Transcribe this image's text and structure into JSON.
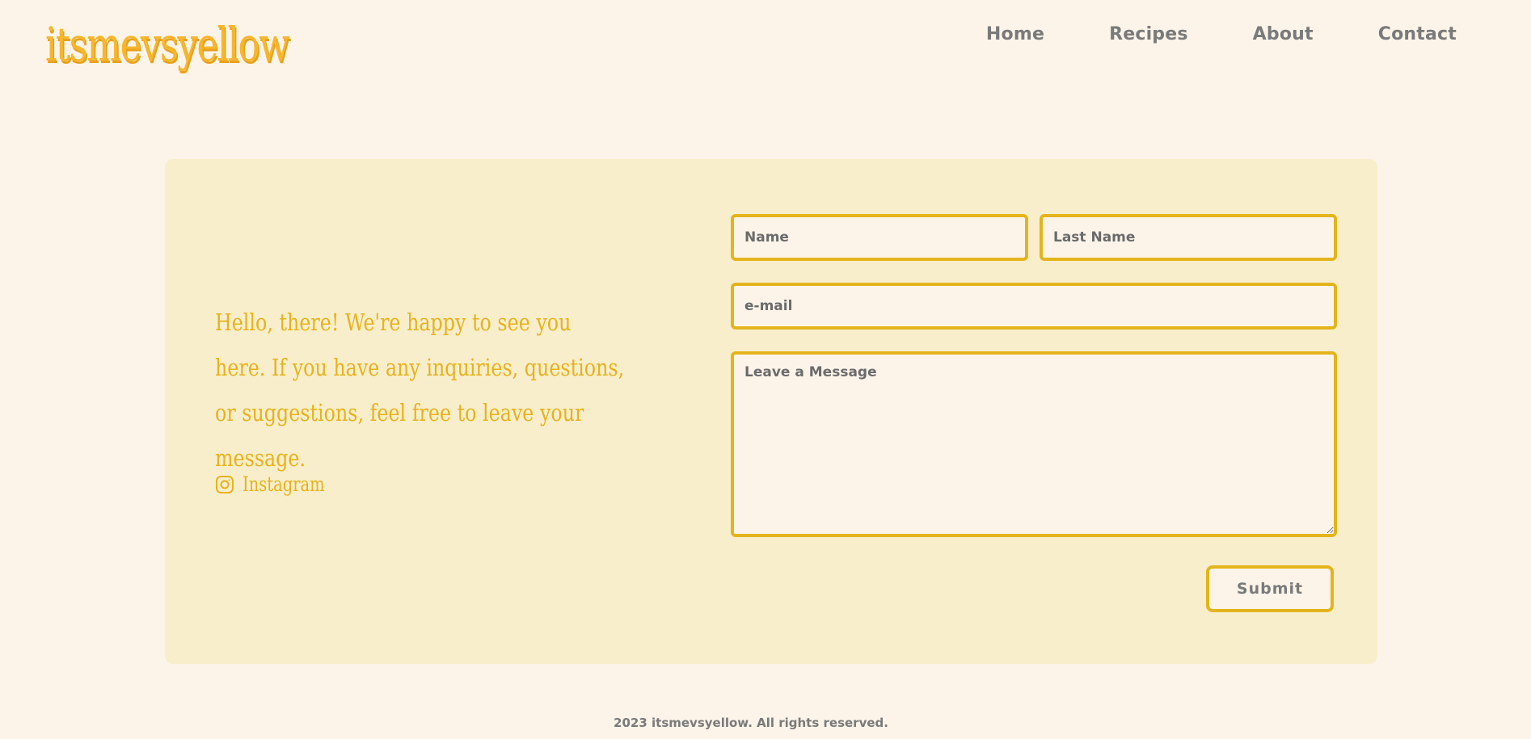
{
  "header": {
    "logo": "itsmevsyellow",
    "nav": [
      {
        "label": "Home"
      },
      {
        "label": "Recipes"
      },
      {
        "label": "About"
      },
      {
        "label": "Contact"
      }
    ]
  },
  "contact": {
    "intro": "Hello, there! We're happy to see you here. If you have any inquiries, questions, or suggestions, feel free to leave your message.",
    "social": {
      "label": "Instagram",
      "icon": "instagram-icon"
    },
    "form": {
      "name_placeholder": "Name",
      "last_name_placeholder": "Last Name",
      "email_placeholder": "e-mail",
      "message_placeholder": "Leave a Message",
      "submit_label": "Submit"
    }
  },
  "footer": {
    "text": "2023 itsmevsyellow. All rights reserved."
  },
  "colors": {
    "background": "#fcf4e9",
    "card": "#f8eecb",
    "accent": "#e4b41c",
    "logo": "#f7b62c",
    "nav_text": "#7a7a7a"
  }
}
